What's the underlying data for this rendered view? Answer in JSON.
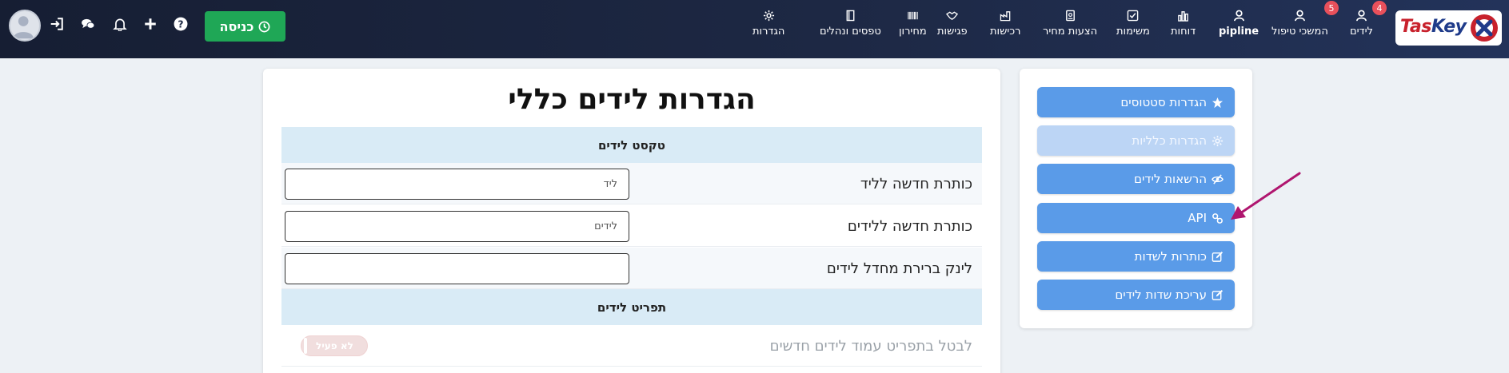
{
  "nav": {
    "logo": "TasKey",
    "items": [
      {
        "label": "לידים",
        "badge": "4",
        "icon": "user-tie-icon"
      },
      {
        "label": "המשכי טיפול",
        "badge": "5",
        "icon": "user-tie-icon"
      },
      {
        "label": "pipline",
        "icon": "user-tie-icon"
      },
      {
        "label": "דוחות",
        "icon": "bar-chart-icon"
      },
      {
        "label": "משימות",
        "icon": "check-square-icon"
      },
      {
        "label": "הצעות מחיר",
        "icon": "file-invoice-icon"
      },
      {
        "label": "רכישות",
        "icon": "industry-icon"
      },
      {
        "label": "פגישות",
        "icon": "handshake-icon"
      },
      {
        "label": "מחירון",
        "icon": "barcode-icon"
      },
      {
        "label": "טפסים ונהלים",
        "icon": "book-icon"
      },
      {
        "label": "הגדרות",
        "icon": "gear-icon"
      }
    ],
    "checkin_label": "כניסה"
  },
  "side_menu": [
    {
      "label": "הגדרות סטטוסים",
      "icon": "star-icon",
      "active": false
    },
    {
      "label": "הגדרות כלליות",
      "icon": "gear-icon",
      "active": true
    },
    {
      "label": "הרשאות לידים",
      "icon": "eye-slash-icon",
      "active": false
    },
    {
      "label": "API",
      "icon": "link-icon",
      "active": false
    },
    {
      "label": "כותרות לשדות",
      "icon": "edit-icon",
      "active": false
    },
    {
      "label": "עריכת שדות לידים",
      "icon": "edit-icon",
      "active": false
    }
  ],
  "main": {
    "title": "הגדרות לידים כללי",
    "sections": [
      {
        "header": "טקסט לידים",
        "rows": [
          {
            "label": "כותרת חדשה לליד",
            "value": "ליד"
          },
          {
            "label": "כותרת חדשה ללידים",
            "value": "לידים"
          },
          {
            "label": "לינק ברירת מחדל לידים",
            "value": ""
          }
        ]
      },
      {
        "header": "תפריט לידים",
        "rows": [
          {
            "label": "לבטל בתפריט עמוד לידים חדשים",
            "toggle": "לא פעיל"
          }
        ]
      }
    ]
  },
  "colors": {
    "topbar": "#1d2844",
    "side_button": "#5a9be8",
    "side_button_active": "#bcd5f5",
    "checkin": "#1fa756",
    "badge": "#e8505b",
    "section_header": "#d9ebf6",
    "arrow": "#b0166f"
  }
}
